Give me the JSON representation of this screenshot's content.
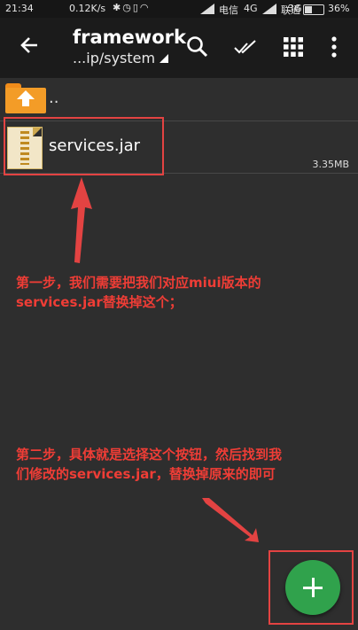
{
  "status_bar": {
    "time": "21:34",
    "speed": "0.12K/s",
    "carrier1": "电信",
    "network1": "4G",
    "carrier2": "联通",
    "network2": "3G",
    "battery": "36%"
  },
  "app_bar": {
    "title": "framework",
    "path": "...ip/system",
    "icons": [
      "back-arrow-icon",
      "search-icon",
      "select-all-icon",
      "grid-view-icon",
      "more-vert-icon"
    ]
  },
  "file_list": {
    "parent_label": "..",
    "items": [
      {
        "name": "services.jar",
        "size": "3.35MB",
        "icon": "zip-file-icon"
      }
    ]
  },
  "annotations": {
    "step1_line1": "第一步，我们需要把我们对应miui版本的",
    "step1_line2": "services.jar替换掉这个；",
    "step2_line1": "第二步，具体就是选择这个按钮，然后找到我",
    "step2_line2": "们修改的services.jar，替换掉原来的即可"
  },
  "colors": {
    "annotation_red": "#e34342",
    "fab_green": "#30a24c",
    "folder_orange": "#f39c27",
    "background": "#2e2e2e",
    "toolbar": "#1b1b1b"
  }
}
